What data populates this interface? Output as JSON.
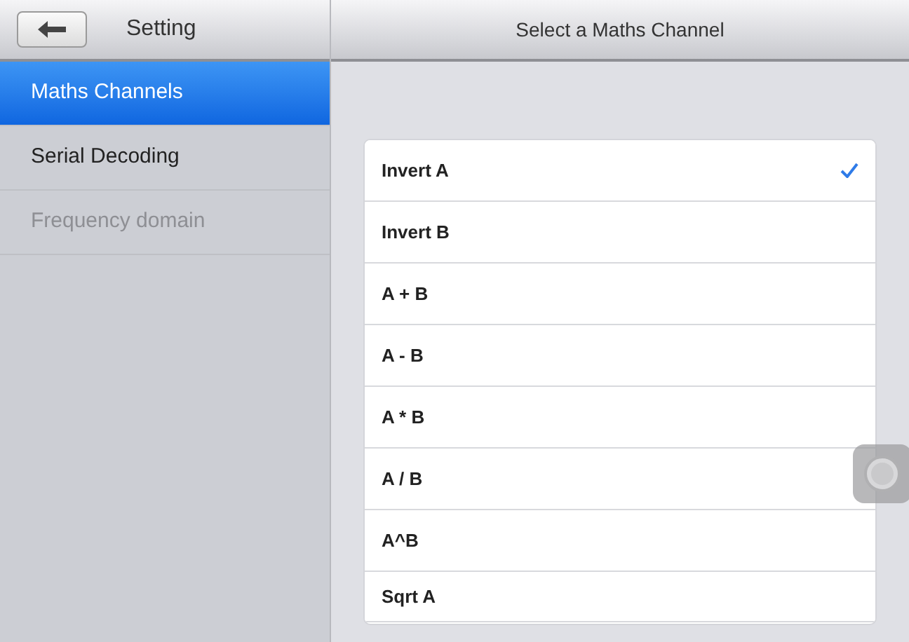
{
  "header": {
    "title": "Setting",
    "panel_title": "Select a Maths Channel"
  },
  "sidebar": {
    "items": [
      {
        "label": "Maths Channels",
        "selected": true,
        "disabled": false
      },
      {
        "label": "Serial Decoding",
        "selected": false,
        "disabled": false
      },
      {
        "label": "Frequency domain",
        "selected": false,
        "disabled": true
      }
    ]
  },
  "channels": [
    {
      "label": "Invert A",
      "selected": true
    },
    {
      "label": "Invert B",
      "selected": false
    },
    {
      "label": "A + B",
      "selected": false
    },
    {
      "label": "A - B",
      "selected": false
    },
    {
      "label": "A * B",
      "selected": false
    },
    {
      "label": "A / B",
      "selected": false
    },
    {
      "label": "A^B",
      "selected": false
    },
    {
      "label": "Sqrt A",
      "selected": false
    }
  ]
}
